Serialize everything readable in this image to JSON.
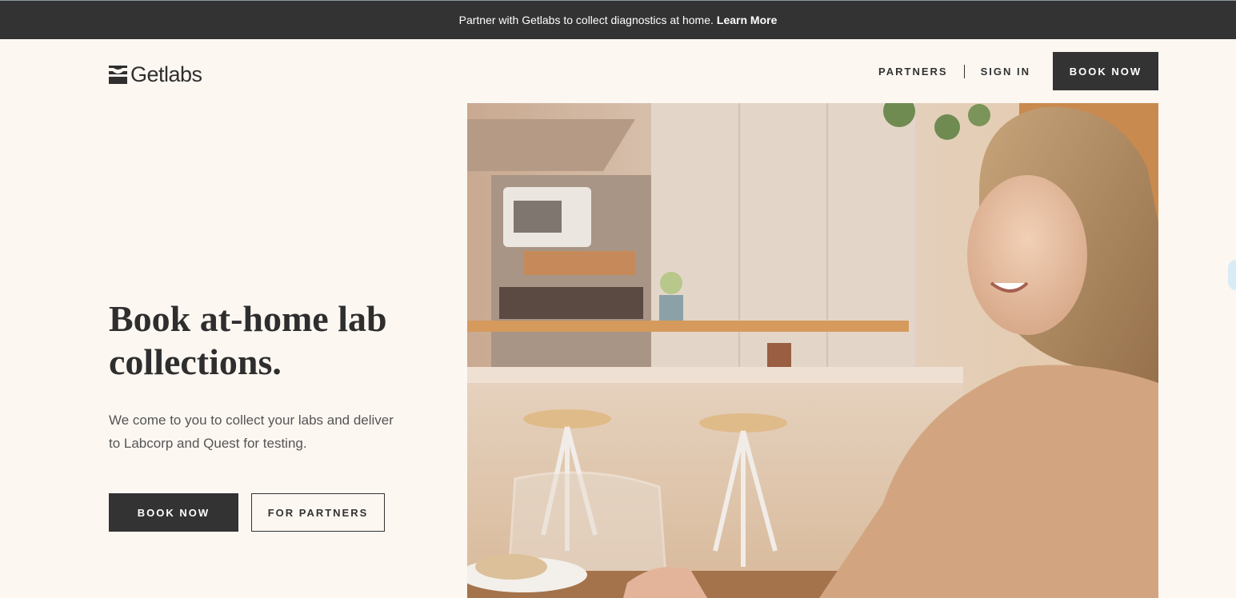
{
  "banner": {
    "text": "Partner with Getlabs to collect diagnostics at home.",
    "link": "Learn More"
  },
  "header": {
    "logo": "Getlabs",
    "nav": {
      "partners": "PARTNERS",
      "sign_in": "SIGN IN",
      "book_now": "BOOK NOW"
    }
  },
  "hero": {
    "title": "Book at-home lab collections.",
    "subtitle": "We come to you to collect your labs and deliver to Labcorp and Quest for testing.",
    "primary_button": "BOOK NOW",
    "secondary_button": "FOR PARTNERS",
    "image_icon": "hero-photo-woman-kitchen"
  },
  "colors": {
    "background": "#fdf7f2",
    "dark": "#333333",
    "text_muted": "#555555"
  }
}
